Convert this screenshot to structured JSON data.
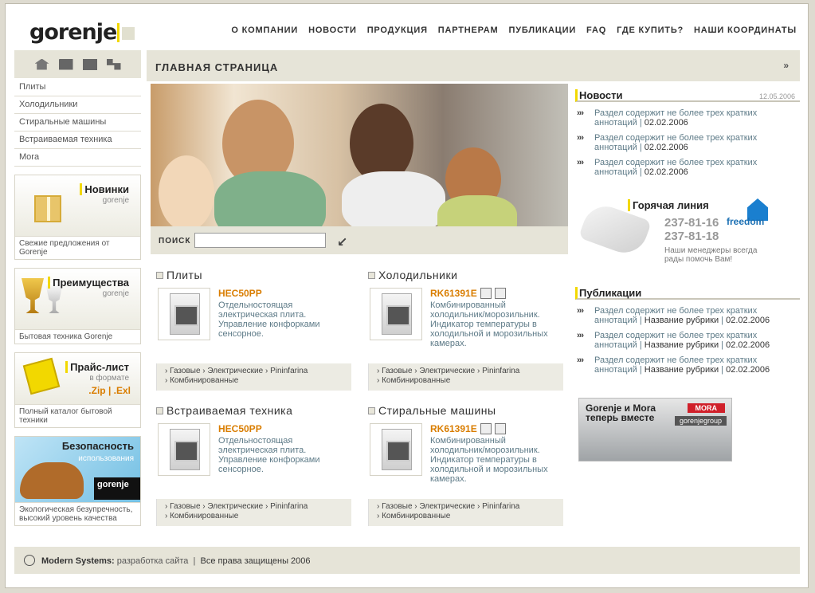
{
  "header": {
    "logo": "gorenje",
    "nav": [
      "О КОМПАНИИ",
      "НОВОСТИ",
      "ПРОДУКЦИЯ",
      "ПАРТНЕРАМ",
      "ПУБЛИКАЦИИ",
      "FAQ",
      "ГДЕ КУПИТЬ?",
      "НАШИ КООРДИНАТЫ"
    ]
  },
  "sidebar": {
    "icons": [
      "home-icon",
      "mail-icon",
      "save-icon",
      "sitemap-icon"
    ],
    "categories": [
      "Плиты",
      "Холодильники",
      "Стиральные машины",
      "Встраиваемая техника",
      "Mora"
    ],
    "promos": [
      {
        "title": "Новинки",
        "sub": "gorenje",
        "caption": "Свежие предложения от Gorenje"
      },
      {
        "title": "Преимущества",
        "sub": "gorenje",
        "caption": "Бытовая техника Gorenje"
      },
      {
        "title": "Прайс-лист",
        "sub": "в формате",
        "ext": ".Zip | .Exl",
        "caption": "Полный каталог бытовой техники"
      },
      {
        "title": "Безопасность",
        "sub": "использования",
        "brand": "gorenje",
        "caption": "Экологическая безупречность, высокий уровень качества"
      }
    ]
  },
  "main": {
    "title": "ГЛАВНАЯ СТРАНИЦА",
    "more": "»",
    "search": {
      "label": "ПОИСК",
      "value": "",
      "go": "↙"
    },
    "products": [
      {
        "category": "Плиты",
        "model": "HEC50PP",
        "desc": "Отдельностоящая электрическая плита. Управление конфорками сенсорное.",
        "links": [
          "Газовые",
          "Электрические",
          "Pininfarina",
          "Комбинированные"
        ]
      },
      {
        "category": "Холодильники",
        "model": "RK61391E",
        "desc": "Комбинированный холодильник/морозильник. Индикатор температуры в холодильной и морозильных камерах.",
        "links": [
          "Газовые",
          "Электрические",
          "Pininfarina",
          "Комбинированные"
        ]
      },
      {
        "category": "Встраиваемая техника",
        "model": "HEC50PP",
        "desc": "Отдельностоящая электрическая плита. Управление конфорками сенсорное.",
        "links": [
          "Газовые",
          "Электрические",
          "Pininfarina",
          "Комбинированные"
        ]
      },
      {
        "category": "Стиральные машины",
        "model": "RK61391E",
        "desc": "Комбинированный холодильник/морозильник. Индикатор температуры в холодильной и морозильных камерах.",
        "links": [
          "Газовые",
          "Электрические",
          "Pininfarina",
          "Комбинированные"
        ]
      }
    ]
  },
  "right": {
    "news": {
      "title": "Новости",
      "date": "12.05.2006",
      "items": [
        {
          "text": "Раздел содержит не более трех кратких аннотаций",
          "date": "02.02.2006"
        },
        {
          "text": "Раздел содержит не более трех кратких аннотаций",
          "date": "02.02.2006"
        },
        {
          "text": "Раздел содержит не более трех кратких аннотаций",
          "date": "02.02.2006"
        }
      ]
    },
    "hotline": {
      "title": "Горячая линия",
      "phone1": "237-81-16",
      "phone2": "237-81-18",
      "note": "Наши менеджеры всегда рады помочь Вам!",
      "brand": "freedom"
    },
    "publications": {
      "title": "Публикации",
      "items": [
        {
          "text": "Раздел содержит не более трех кратких аннотаций",
          "rubric": "Название рубрики",
          "date": "02.02.2006"
        },
        {
          "text": "Раздел содержит не более трех кратких аннотаций",
          "rubric": "Название рубрики",
          "date": "02.02.2006"
        },
        {
          "text": "Раздел содержит не более трех кратких аннотаций",
          "rubric": "Название рубрики",
          "date": "02.02.2006"
        }
      ]
    },
    "banner": {
      "text": "Gorenje и Mora теперь вместе",
      "badge": "MORA",
      "group": "gorenjegroup"
    }
  },
  "footer": {
    "company": "Modern Systems:",
    "service": "разработка сайта",
    "sep": "|",
    "rights": "Все права защищены 2006"
  }
}
